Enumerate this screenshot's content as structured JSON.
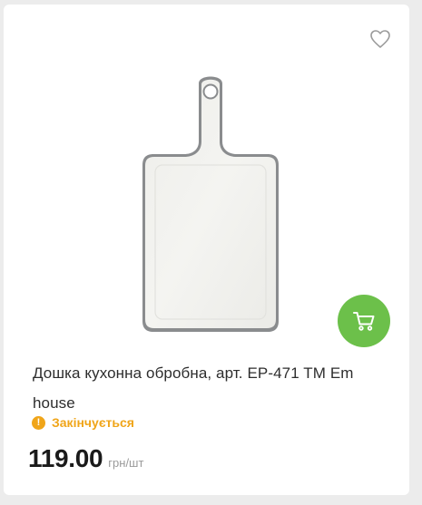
{
  "product": {
    "title": "Дошка кухонна обробна, арт. EP-471 TM Em house",
    "status": "Закінчується",
    "price": "119.00",
    "unit": "грн/шт",
    "image_icon": "cutting-board-image"
  },
  "icons": {
    "wishlist": "heart-outline-icon",
    "cart": "cart-icon",
    "status": "exclamation-circle-icon"
  },
  "colors": {
    "accent_green": "#6cc04a",
    "warning_orange": "#f0a519",
    "price_text": "#1a1a1a",
    "unit_text": "#9a9a9a"
  }
}
